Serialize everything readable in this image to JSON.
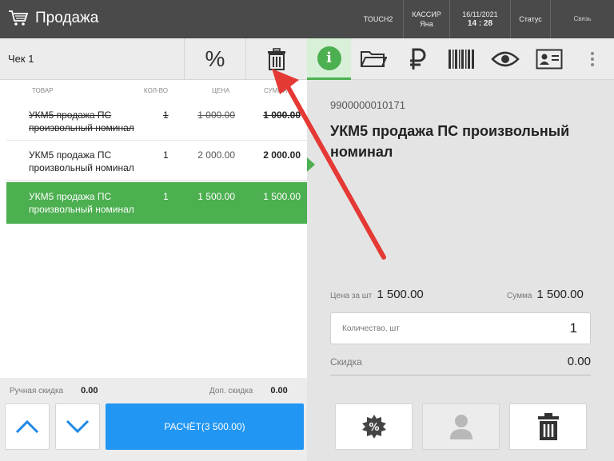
{
  "header": {
    "title": "Продажа",
    "store": "TOUCH2",
    "cashier_label": "КАССИР",
    "cashier_name": "Яна",
    "date": "16/11/2021",
    "time": "14 : 28",
    "status_label": "Статус",
    "link_label": "Связь",
    "icon": "cart-icon"
  },
  "receipt": {
    "label": "Чек 1",
    "percent_label": "%",
    "columns": [
      "ТОВАР",
      "КОЛ-ВО",
      "ЦЕНА",
      "СУММА"
    ],
    "rows": [
      {
        "name": "УКМ5 продажа ПС произвольный номинал",
        "qty": "1",
        "price": "1 000.00",
        "sum": "1 000.00",
        "state": "deleted"
      },
      {
        "name": "УКМ5 продажа ПС произвольный номинал",
        "qty": "1",
        "price": "2 000.00",
        "sum": "2 000.00",
        "state": "normal"
      },
      {
        "name": "УКМ5 продажа ПС произвольный номинал",
        "qty": "1",
        "price": "1 500.00",
        "sum": "1 500.00",
        "state": "selected"
      }
    ],
    "manual_discount_label": "Ручная скидка",
    "manual_discount_value": "0.00",
    "extra_discount_label": "Доп. скидка",
    "extra_discount_value": "0.00",
    "pay_label": "РАСЧЁТ(3 500.00)"
  },
  "details": {
    "barcode": "9900000010171",
    "product_name": "УКМ5 продажа ПС произвольный номинал",
    "unit_price_label": "Цена за шт",
    "unit_price": "1 500.00",
    "sum_label": "Сумма",
    "sum": "1 500.00",
    "qty_label": "Количество, шт",
    "qty": "1",
    "discount_label": "Скидка",
    "discount": "0.00",
    "tabs": [
      "info-icon",
      "folder-icon",
      "ruble-icon",
      "barcode-icon",
      "eye-icon",
      "id-card-icon",
      "more-icon"
    ]
  },
  "colors": {
    "topbar": "#4a4a4a",
    "accent_green": "#4caf50",
    "pay_blue": "#2196f3",
    "annotation_red": "#e53935"
  }
}
